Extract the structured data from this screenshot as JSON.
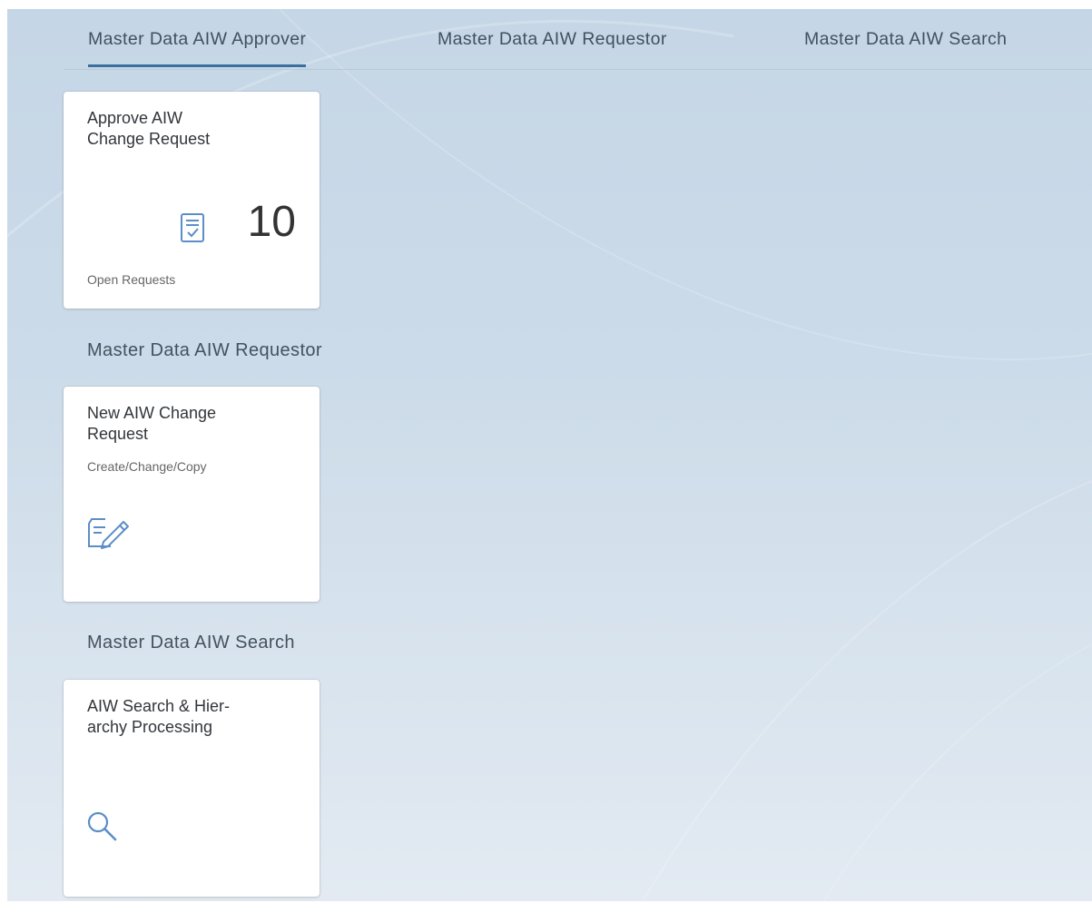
{
  "anchor_bar": {
    "tabs": [
      {
        "label": "Master Data AIW Approver",
        "selected": true
      },
      {
        "label": "Master Data AIW Requestor",
        "selected": false
      },
      {
        "label": "Master Data AIW Search",
        "selected": false
      }
    ]
  },
  "groups": [
    {
      "title": "",
      "tile": {
        "title": "Approve AIW\nChange Request",
        "icon": "approval-document-icon",
        "number": "10",
        "footer": "Open Requests"
      }
    },
    {
      "title": "Master Data AIW Requestor",
      "tile": {
        "title": "New AIW Change\nRequest",
        "subtitle": "Create/Change/Copy",
        "icon": "edit-document-icon"
      }
    },
    {
      "title": "Master Data AIW Search",
      "tile": {
        "title": "AIW Search & Hier-\narchy Processing",
        "icon": "search-icon"
      }
    }
  ],
  "colors": {
    "accent": "#3b6fa0",
    "icon": "#5b8ec7",
    "text": "#32363a",
    "background": "#cbd9e7"
  }
}
